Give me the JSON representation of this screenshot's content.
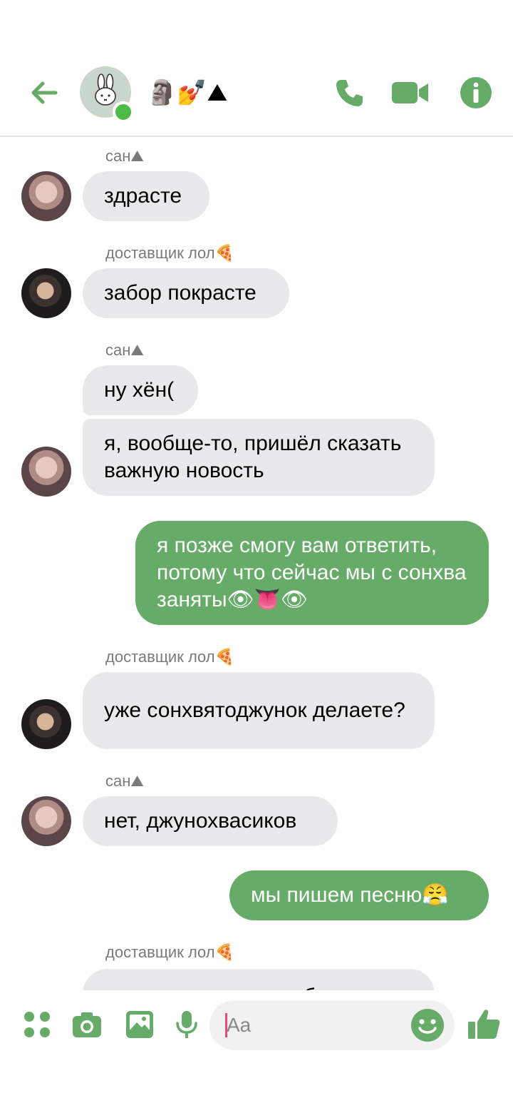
{
  "colors": {
    "accent": "#66ac68",
    "incoming_bubble": "#e9e9eb",
    "outgoing_text": "#ffffff",
    "online": "#4cbb45"
  },
  "header": {
    "title": "🗿💅⛰",
    "icons": [
      "back-arrow-icon",
      "phone-icon",
      "video-camera-icon",
      "info-icon"
    ]
  },
  "messages": [
    {
      "sender": "сан⛰",
      "text": "здрасте",
      "direction": "incoming"
    },
    {
      "sender": "доставщик лол🍕",
      "text": "забор покрасте",
      "direction": "incoming"
    },
    {
      "sender": "сан⛰",
      "text": "ну хён(",
      "direction": "incoming"
    },
    {
      "text": "я, вообще-то, пришёл сказать важную новость",
      "direction": "incoming"
    },
    {
      "text": "я позже смогу вам ответить, потому что сейчас мы с сонхва заняты👁👅👁",
      "direction": "outgoing"
    },
    {
      "sender": "доставщик лол🍕",
      "text": "уже сонхвятоджунок делаете?",
      "direction": "incoming"
    },
    {
      "sender": "сан⛰",
      "text": "нет, джунохвасиков",
      "direction": "incoming"
    },
    {
      "text": "мы пишем песню😤",
      "direction": "outgoing"
    },
    {
      "sender": "доставщик лол🍕",
      "text": "не припоминаю, чтобы ты",
      "direction": "incoming"
    }
  ],
  "composer": {
    "placeholder": "Aa",
    "icons": [
      "apps-grid-icon",
      "camera-icon",
      "gallery-icon",
      "microphone-icon",
      "emoji-icon",
      "thumbs-up-icon"
    ]
  }
}
